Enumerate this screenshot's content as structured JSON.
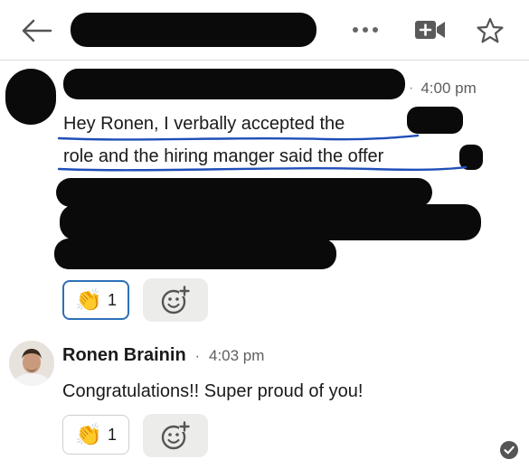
{
  "header": {
    "back_icon": "arrow-left-icon",
    "more_icon": "more-horizontal-icon",
    "video_icon": "video-plus-icon",
    "star_icon": "star-outline-icon"
  },
  "message1": {
    "time": "4:00 pm",
    "line1": "Hey Ronen, I verbally accepted the",
    "line2": "role and the hiring manger said the offer",
    "reaction": {
      "emoji": "👏",
      "count": "1"
    },
    "annotation_color": "#1f4fb8"
  },
  "message2": {
    "sender": "Ronen Brainin",
    "separator": "·",
    "time": "4:03 pm",
    "text": "Congratulations!! Super proud of you!",
    "reaction": {
      "emoji": "👏",
      "count": "1"
    }
  },
  "status": {
    "icon": "check-circle-icon"
  },
  "colors": {
    "accent": "#2d6fb7",
    "text": "#1a1a1a",
    "muted": "#5e5e5e"
  }
}
